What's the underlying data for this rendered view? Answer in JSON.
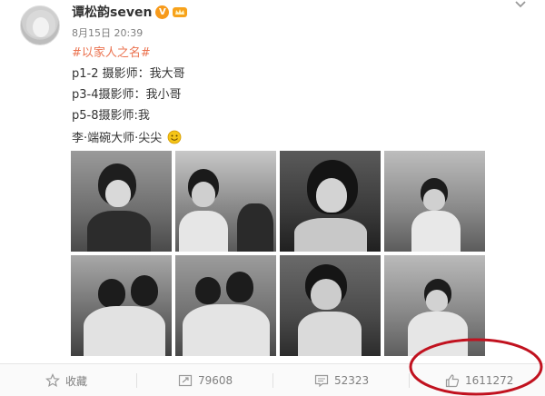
{
  "post": {
    "author": "谭松韵seven",
    "verified_badge": "V",
    "time": "8月15日 20:39",
    "hashtag": "#以家人之名#",
    "lines": [
      "p1-2 摄影师：我大哥",
      "p3-4摄影师：我小哥",
      "p5-8摄影师:我",
      "李·端碗大师·尖尖"
    ]
  },
  "photos": [
    {
      "name": "photo-1"
    },
    {
      "name": "photo-2"
    },
    {
      "name": "photo-3"
    },
    {
      "name": "photo-4"
    },
    {
      "name": "photo-5"
    },
    {
      "name": "photo-6"
    },
    {
      "name": "photo-7"
    },
    {
      "name": "photo-8"
    }
  ],
  "actions": {
    "favorite_label": "收藏",
    "repost_count": "79608",
    "comment_count": "52323",
    "like_count": "1611272"
  },
  "icons": {
    "favorite": "star-icon",
    "repost": "repost-icon",
    "comment": "comment-icon",
    "like": "thumbs-up-icon",
    "menu": "chevron-down-icon",
    "crown": "crown-icon",
    "emoji": "smile-icon"
  },
  "colors": {
    "hashtag": "#eb7350",
    "annotation": "#c1121f",
    "verified": "#f79a1a"
  }
}
